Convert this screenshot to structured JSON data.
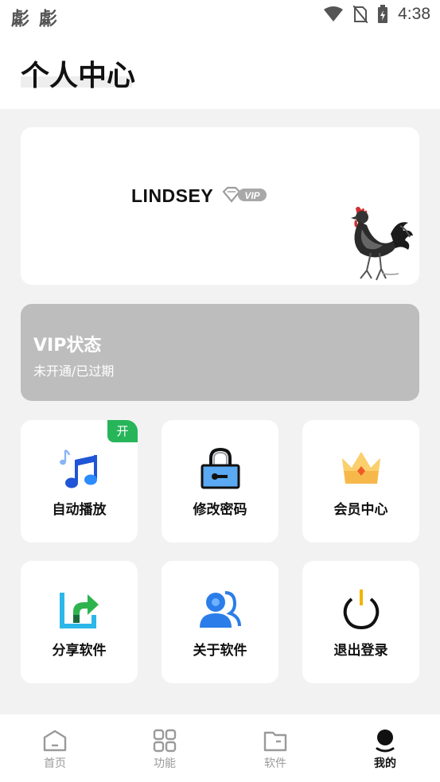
{
  "statusbar": {
    "left_icons": "虨 虨",
    "time": "4:38"
  },
  "header": {
    "title": "个人中心"
  },
  "profile": {
    "username": "LINDSEY",
    "badge": "VIP"
  },
  "vip": {
    "title": "VIP状态",
    "status": "未开通/已过期"
  },
  "tiles": [
    {
      "label": "自动播放",
      "icon": "music-note-icon",
      "badge": "开"
    },
    {
      "label": "修改密码",
      "icon": "padlock-icon"
    },
    {
      "label": "会员中心",
      "icon": "crown-icon"
    },
    {
      "label": "分享软件",
      "icon": "share-icon"
    },
    {
      "label": "关于软件",
      "icon": "users-icon"
    },
    {
      "label": "退出登录",
      "icon": "power-icon"
    }
  ],
  "tabs": [
    {
      "label": "首页",
      "icon": "home-icon"
    },
    {
      "label": "功能",
      "icon": "grid-icon"
    },
    {
      "label": "软件",
      "icon": "folder-icon"
    },
    {
      "label": "我的",
      "icon": "profile-icon",
      "active": true
    }
  ],
  "colors": {
    "badge_green": "#27b55a",
    "vip_card": "#bdbdbd",
    "active_tab": "#111111",
    "inactive_tab": "#9a9a9a"
  }
}
